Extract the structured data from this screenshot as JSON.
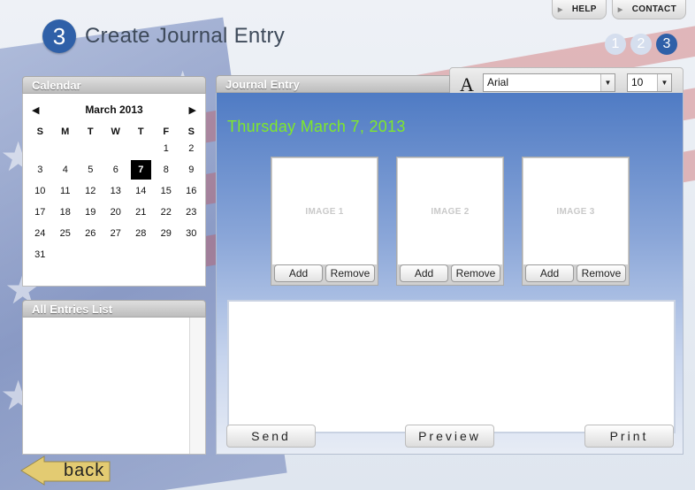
{
  "nav": {
    "help": "HELP",
    "contact": "CONTACT"
  },
  "header": {
    "step": "3",
    "title": "Create Journal Entry",
    "steps": [
      "1",
      "2",
      "3"
    ]
  },
  "calendar": {
    "title": "Calendar",
    "month": "March 2013",
    "weekdays": [
      "S",
      "M",
      "T",
      "W",
      "T",
      "F",
      "S"
    ],
    "selected_day": "7",
    "days": [
      "",
      "",
      "",
      "",
      "",
      "1",
      "2",
      "3",
      "4",
      "5",
      "6",
      "7",
      "8",
      "9",
      "10",
      "11",
      "12",
      "13",
      "14",
      "15",
      "16",
      "17",
      "18",
      "19",
      "20",
      "21",
      "22",
      "23",
      "24",
      "25",
      "26",
      "27",
      "28",
      "29",
      "30",
      "31"
    ]
  },
  "entries": {
    "title": "All Entries List"
  },
  "journal": {
    "title": "Journal Entry",
    "date": "Thursday March 7, 2013",
    "font": "Arial",
    "font_size": "10",
    "images": [
      {
        "label": "IMAGE 1",
        "add": "Add",
        "remove": "Remove"
      },
      {
        "label": "IMAGE 2",
        "add": "Add",
        "remove": "Remove"
      },
      {
        "label": "IMAGE 3",
        "add": "Add",
        "remove": "Remove"
      }
    ],
    "send": "Send",
    "preview": "Preview",
    "print": "Print"
  },
  "back": {
    "label": "back"
  },
  "colors": {
    "accent": "#2f60a8",
    "date_green": "#7fe82a"
  }
}
